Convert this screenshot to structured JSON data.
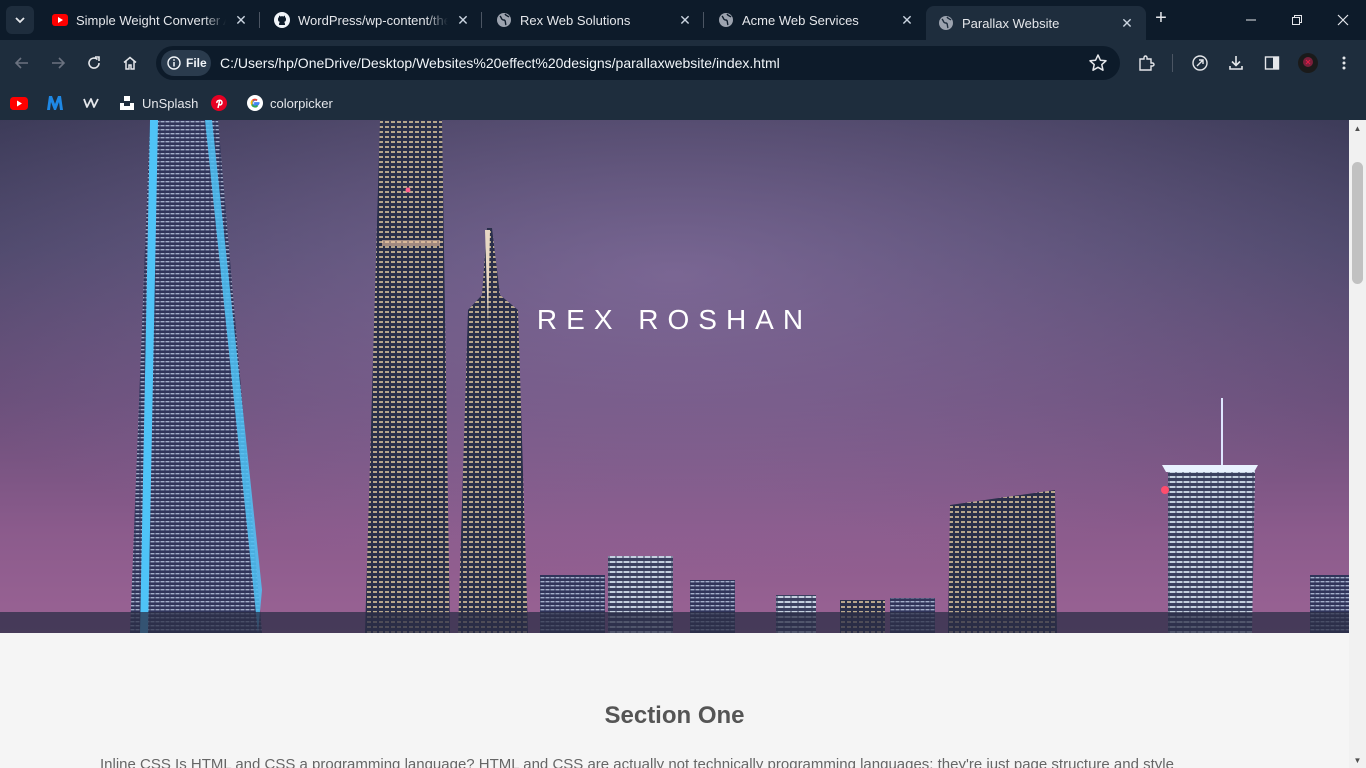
{
  "browser": {
    "tabs": [
      {
        "title": "Simple Weight Converter Ap",
        "favicon": "youtube-icon",
        "active": false
      },
      {
        "title": "WordPress/wp-content/them",
        "favicon": "github-icon",
        "active": false
      },
      {
        "title": "Rex Web Solutions",
        "favicon": "globe-icon",
        "active": false
      },
      {
        "title": "Acme Web Services",
        "favicon": "globe-icon",
        "active": false
      },
      {
        "title": "Parallax Website",
        "favicon": "globe-icon",
        "active": true
      }
    ],
    "close_glyph": "✕",
    "new_tab_glyph": "+",
    "address": {
      "chip_label": "File",
      "url": "C:/Users/hp/OneDrive/Desktop/Websites%20effect%20designs/parallaxwebsite/index.html"
    },
    "bookmarks": [
      {
        "label": "",
        "icon": "youtube-icon"
      },
      {
        "label": "",
        "icon": "m-logo-icon"
      },
      {
        "label": "",
        "icon": "webflow-icon"
      },
      {
        "label": "UnSplash",
        "icon": "unsplash-icon"
      },
      {
        "label": "",
        "icon": "pinterest-icon"
      },
      {
        "label": "colorpicker",
        "icon": "google-icon"
      }
    ],
    "colors": {
      "frame": "#0d1b2a",
      "toolbar": "#1e2d3d",
      "youtube_red": "#ff0000",
      "pinterest_red": "#e60023",
      "m_blue": "#1e88e5"
    }
  },
  "page": {
    "hero_title": "REX ROSHAN",
    "section_title": "Section One",
    "section_text": "Inline CSS Is HTML and CSS a programming language? HTML and CSS are actually not technically programming languages; they're just page structure and style"
  }
}
